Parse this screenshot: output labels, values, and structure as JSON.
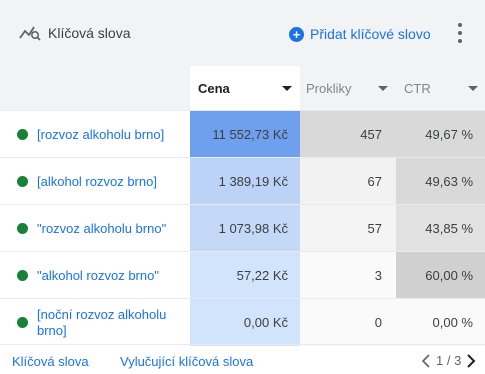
{
  "header": {
    "title": "Klíčová slova",
    "add_label": "Přidat klíčové slovo"
  },
  "columns": {
    "cena": "Cena",
    "prokliky": "Prokliky",
    "ctr": "CTR"
  },
  "rows": [
    {
      "keyword": "[rozvoz alkoholu brno]",
      "cena": "11 552,73 Kč",
      "prokliky": "457",
      "ctr": "49,67 %",
      "status": "active"
    },
    {
      "keyword": "[alkohol rozvoz brno]",
      "cena": "1 389,19 Kč",
      "prokliky": "67",
      "ctr": "49,63 %",
      "status": "active"
    },
    {
      "keyword": "\"rozvoz alkoholu brno\"",
      "cena": "1 073,98 Kč",
      "prokliky": "57",
      "ctr": "43,85 %",
      "status": "active"
    },
    {
      "keyword": "\"alkohol rozvoz brno\"",
      "cena": "57,22 Kč",
      "prokliky": "3",
      "ctr": "60,00 %",
      "status": "active"
    },
    {
      "keyword": "[noční rozvoz alkoholu brno]",
      "cena": "0,00 Kč",
      "prokliky": "0",
      "ctr": "0,00 %",
      "status": "active"
    }
  ],
  "footer": {
    "tab_keywords": "Klíčová slova",
    "tab_negative": "Vylučující klíčová slova",
    "pager": "1 / 3"
  },
  "colors": {
    "accent": "#1a73e8",
    "status_active": "#188038",
    "cena_heat": [
      "#6fa0ee",
      "#bcd3f7",
      "#c4d8f8",
      "#d2e3fc",
      "#d2e3fc"
    ],
    "prokliky_heat": [
      "#d9d9d9",
      "#f2f2f2",
      "#f4f4f4",
      "#fafafa",
      "#fafafa"
    ],
    "ctr_heat": [
      "#d9d9d9",
      "#d9d9d9",
      "#e1e1e1",
      "#d0d0d0",
      "#fafafa"
    ]
  },
  "icons": {
    "title": "keyword-chart-icon",
    "add": "add-circle-icon",
    "more": "more-vert-icon",
    "prev": "chevron-left-icon",
    "next": "chevron-right-icon"
  }
}
